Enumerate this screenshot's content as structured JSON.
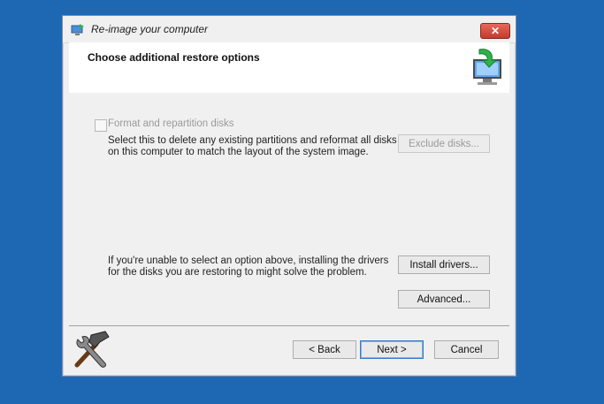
{
  "window": {
    "title": "Re-image your computer",
    "close_glyph": "✕"
  },
  "header": {
    "title": "Choose additional restore options"
  },
  "options": {
    "format_label": "Format and repartition disks",
    "format_checked": false,
    "format_desc_line1": "Select this to delete any existing partitions and reformat all disks",
    "format_desc_line2": "on this computer to match the layout of the system image.",
    "exclude_label": "Exclude disks...",
    "drivers_desc_line1": "If you're unable to select an option above, installing the drivers",
    "drivers_desc_line2": "for the disks you are restoring to might solve the problem.",
    "install_label": "Install drivers...",
    "advanced_label": "Advanced..."
  },
  "footer": {
    "back_label": "< Back",
    "next_label": "Next >",
    "cancel_label": "Cancel"
  },
  "icons": {
    "window_icon": "computer-restore-icon",
    "header_icon": "computer-restore-icon",
    "logo": "hammer-wrench-icon"
  },
  "colors": {
    "desktop": "#1e68b3",
    "dialog_bg": "#f0f0f0",
    "close": "#c8392d"
  }
}
